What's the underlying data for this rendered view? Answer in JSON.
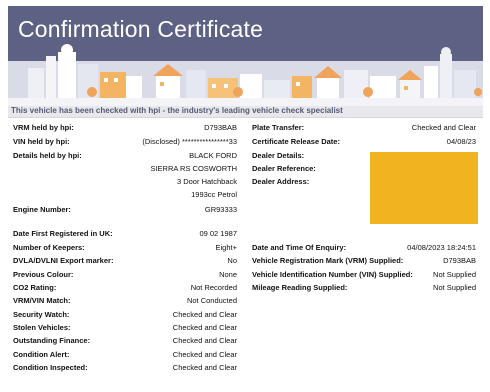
{
  "header": {
    "title": "Confirmation Certificate",
    "tagline": "This vehicle has been checked with hpi - the industry's leading vehicle check specialist",
    "banner_color": "#5d6284"
  },
  "left": {
    "vrm_label": "VRM held by hpi:",
    "vrm_value": "D793BAB",
    "vin_label": "VIN held by hpi:",
    "vin_value": "(Disclosed) ****************33",
    "details_label": "Details held by hpi:",
    "details_lines": [
      "BLACK FORD",
      "SIERRA RS COSWORTH",
      "3 Door Hatchback",
      "1993cc Petrol"
    ],
    "engine_label": "Engine Number:",
    "engine_value": "GR93333",
    "first_reg_label": "Date First Registered in UK:",
    "first_reg_value": "09 02 1987",
    "keepers_label": "Number of Keepers:",
    "keepers_value": "Eight+",
    "export_label": "DVLA/DVLNI Export marker:",
    "export_value": "No",
    "prev_colour_label": "Previous Colour:",
    "prev_colour_value": "None",
    "co2_label": "CO2 Rating:",
    "co2_value": "Not Recorded",
    "vrm_vin_match_label": "VRM/VIN Match:",
    "vrm_vin_match_value": "Not Conducted",
    "security_label": "Security Watch:",
    "security_value": "Checked and Clear",
    "stolen_label": "Stolen Vehicles:",
    "stolen_value": "Checked and Clear",
    "finance_label": "Outstanding Finance:",
    "finance_value": "Checked and Clear",
    "condition_alert_label": "Condition Alert:",
    "condition_alert_value": "Checked and Clear",
    "condition_inspected_label": "Condition Inspected:",
    "condition_inspected_value": "Checked and Clear"
  },
  "right": {
    "plate_label": "Plate Transfer:",
    "plate_value": "Checked and Clear",
    "cert_date_label": "Certificate Release Date:",
    "cert_date_value": "04/08/23",
    "dealer_details_label": "Dealer Details:",
    "dealer_reference_label": "Dealer Reference:",
    "dealer_address_label": "Dealer Address:",
    "redaction_color": "#f2b321",
    "enquiry_label": "Date and Time Of Enquiry:",
    "enquiry_value": "04/08/2023 18:24:51",
    "vrm_supplied_label": "Vehicle Registration Mark (VRM) Supplied:",
    "vrm_supplied_value": "D793BAB",
    "vin_supplied_label": "Vehicle Identification Number (VIN) Supplied:",
    "vin_supplied_value": "Not Supplied",
    "mileage_label": "Mileage Reading Supplied:",
    "mileage_value": "Not Supplied"
  }
}
